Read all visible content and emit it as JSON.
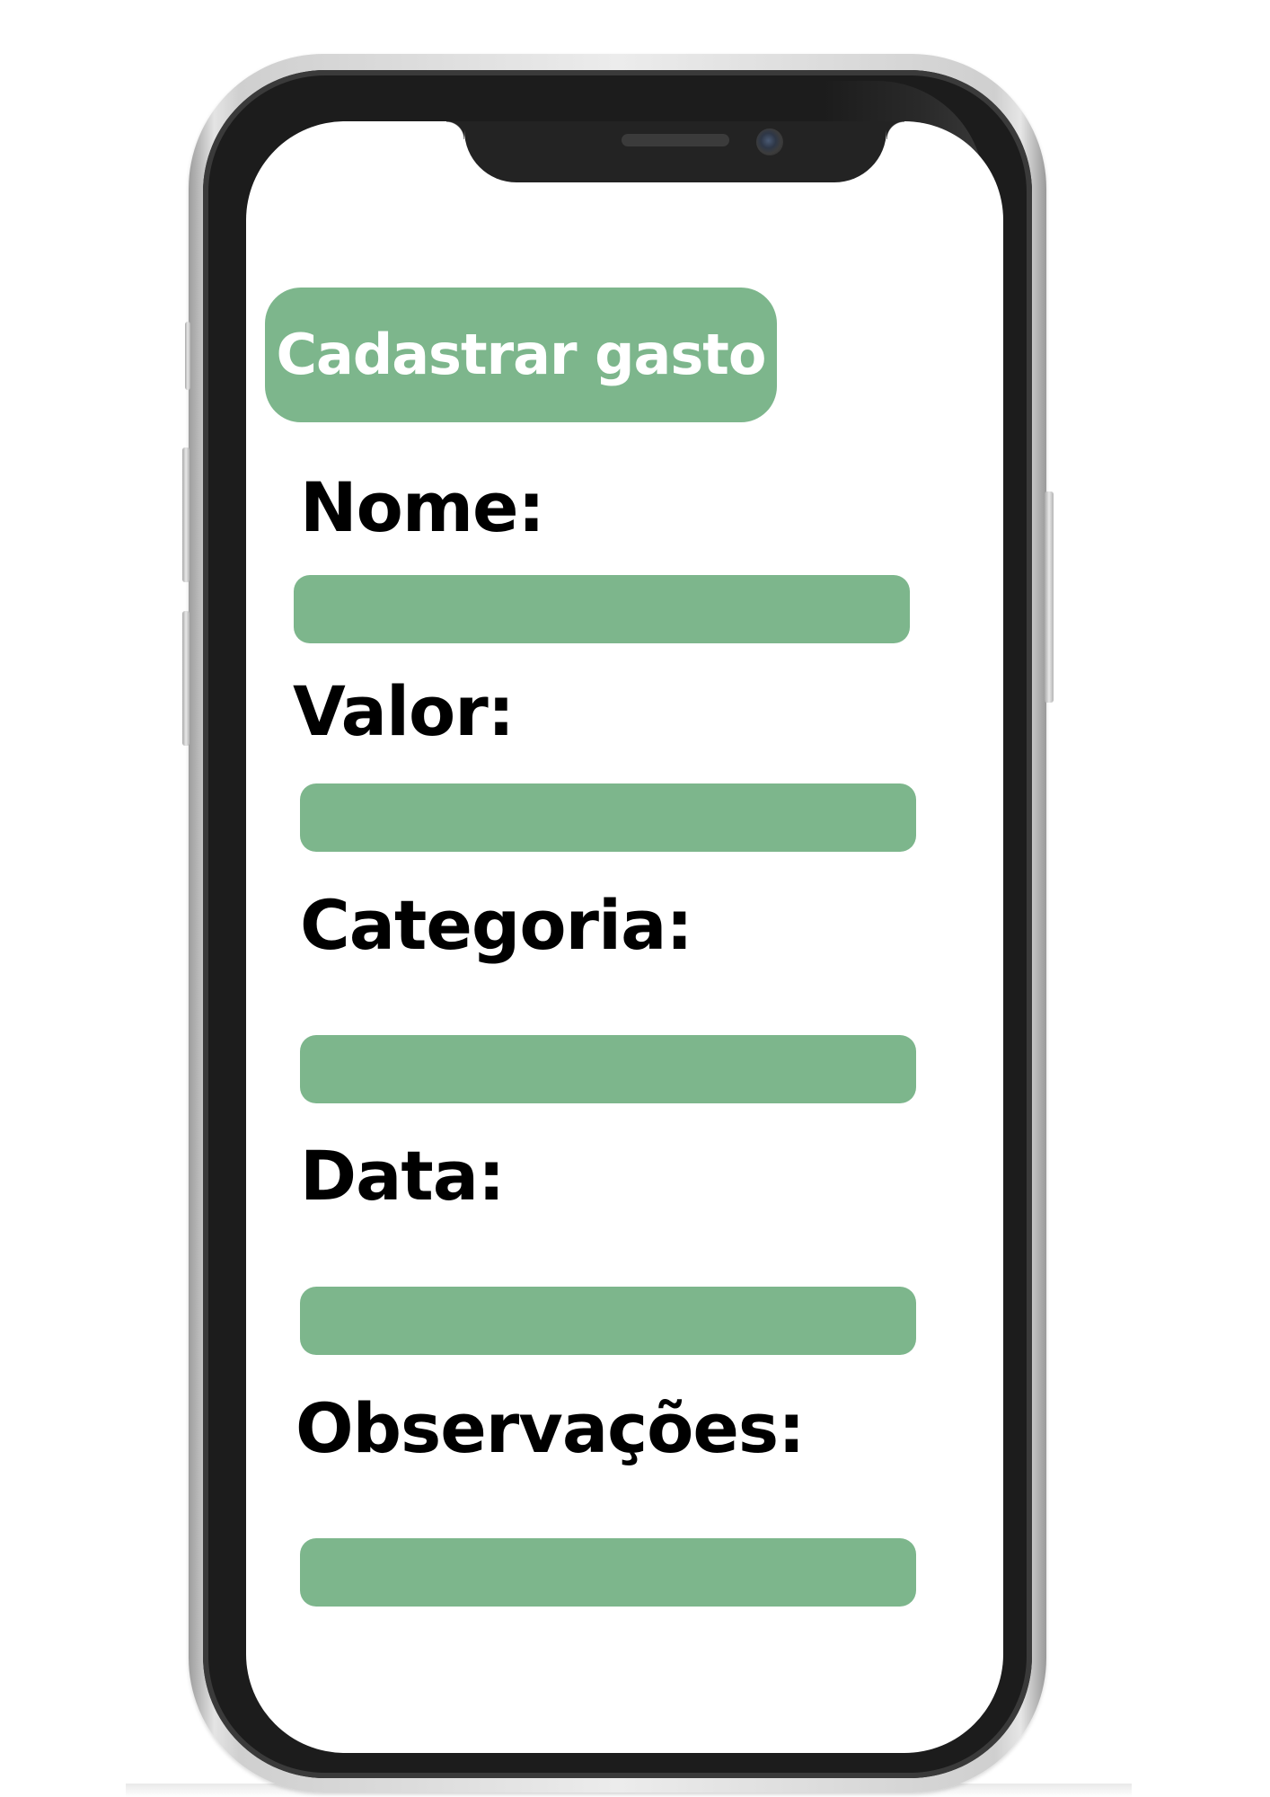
{
  "form": {
    "title_button": "Cadastrar gasto",
    "fields": [
      {
        "label": "Nome:",
        "value": ""
      },
      {
        "label": "Valor:",
        "value": ""
      },
      {
        "label": "Categoria:",
        "value": ""
      },
      {
        "label": "Data:",
        "value": ""
      },
      {
        "label": "Observações:",
        "value": ""
      }
    ]
  },
  "colors": {
    "accent": "#7db68c",
    "label_text": "#000000",
    "title_text": "#ffffff",
    "screen_bg": "#ffffff",
    "bezel": "#1c1c1c"
  }
}
